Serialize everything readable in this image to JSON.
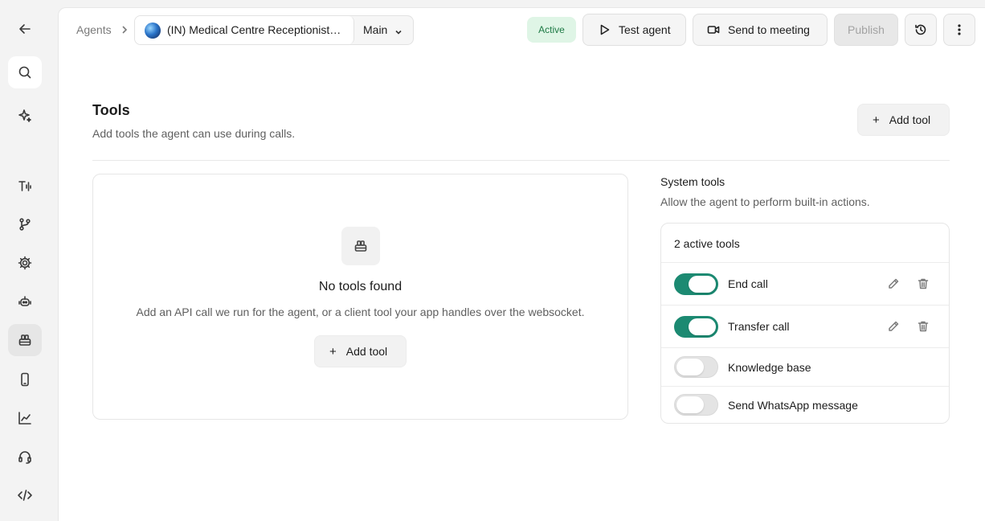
{
  "header": {
    "breadcrumb": "Agents",
    "agent_name": "(IN) Medical Centre Receptionist…",
    "branch": "Main",
    "status": "Active",
    "test_agent": "Test agent",
    "send_to_meeting": "Send to meeting",
    "publish": "Publish"
  },
  "tools": {
    "title": "Tools",
    "subtitle": "Add tools the agent can use during calls.",
    "add_tool": "Add tool",
    "empty_title": "No tools found",
    "empty_desc": "Add an API call we run for the agent, or a client tool your app handles over the websocket.",
    "empty_add_tool": "Add tool"
  },
  "system_tools": {
    "title": "System tools",
    "subtitle": "Allow the agent to perform built-in actions.",
    "count_label": "2 active tools",
    "items": [
      {
        "label": "End call",
        "enabled": true
      },
      {
        "label": "Transfer call",
        "enabled": true
      },
      {
        "label": "Knowledge base",
        "enabled": false
      },
      {
        "label": "Send WhatsApp message",
        "enabled": false
      }
    ]
  },
  "sidebar": {
    "items": [
      "back-arrow-icon",
      "search-icon",
      "sparkle-icon",
      "voice-icon",
      "branch-icon",
      "gear-icon",
      "robot-icon",
      "tools-icon",
      "phone-icon",
      "chart-icon",
      "headset-icon",
      "code-icon"
    ],
    "active": "tools-icon"
  },
  "colors": {
    "accent": "#1c8a72",
    "active_badge_bg": "#dff5e6",
    "active_badge_text": "#1e7a45"
  }
}
